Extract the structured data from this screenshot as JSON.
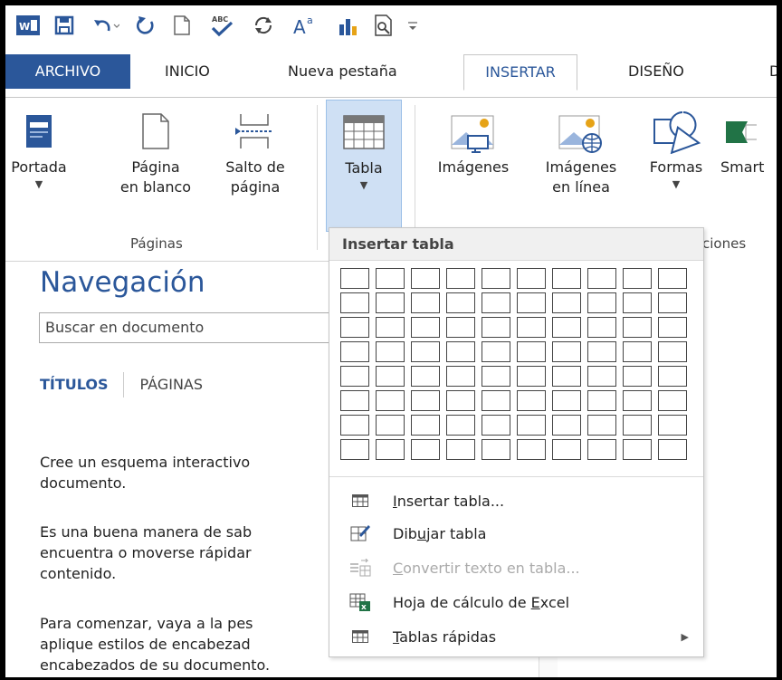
{
  "tabs": {
    "file": "ARCHIVO",
    "home": "INICIO",
    "new_tab": "Nueva pestaña",
    "insert": "INSERTAR",
    "design": "DISEÑO",
    "next_partial": "D"
  },
  "ribbon": {
    "cover": "Portada",
    "blank_page_1": "Página",
    "blank_page_2": "en blanco",
    "page_break_1": "Salto de",
    "page_break_2": "página",
    "table": "Tabla",
    "pictures": "Imágenes",
    "online_pictures_1": "Imágenes",
    "online_pictures_2": "en línea",
    "shapes": "Formas",
    "smartart_partial": "Smart",
    "group_pages": "Páginas",
    "group_illustrations_partial": "ciones"
  },
  "nav": {
    "title": "Navegación",
    "search_placeholder": "Buscar en documento",
    "tab_headings": "TÍTULOS",
    "tab_pages": "PÁGINAS",
    "para1_line1": "Cree un esquema interactivo",
    "para1_line2": "documento.",
    "para2_line1": "Es una buena manera de sab",
    "para2_line2": "encuentra o moverse rápidar",
    "para2_line3": "contenido.",
    "para3_line1": "Para comenzar, vaya a la pes",
    "para3_line2": "aplique estilos de encabezad",
    "para3_line3": "encabezados de su documento."
  },
  "dropdown": {
    "header": "Insertar tabla",
    "grid_cols": 10,
    "grid_rows": 8,
    "items": [
      {
        "pre": "",
        "u": "I",
        "post": "nsertar tabla...",
        "icon": "table-icon",
        "disabled": false
      },
      {
        "pre": "Dib",
        "u": "u",
        "post": "jar tabla",
        "icon": "draw-table-icon",
        "disabled": false
      },
      {
        "pre": "",
        "u": "C",
        "post": "onvertir texto en tabla...",
        "icon": "convert-text-icon",
        "disabled": true
      },
      {
        "pre": "Hoja de cálculo de ",
        "u": "E",
        "post": "xcel",
        "icon": "excel-sheet-icon",
        "disabled": false
      },
      {
        "pre": "",
        "u": "T",
        "post": "ablas rápidas",
        "icon": "quick-tables-icon",
        "disabled": false
      }
    ]
  },
  "colors": {
    "accent": "#2b579a",
    "excel_green": "#217346"
  }
}
